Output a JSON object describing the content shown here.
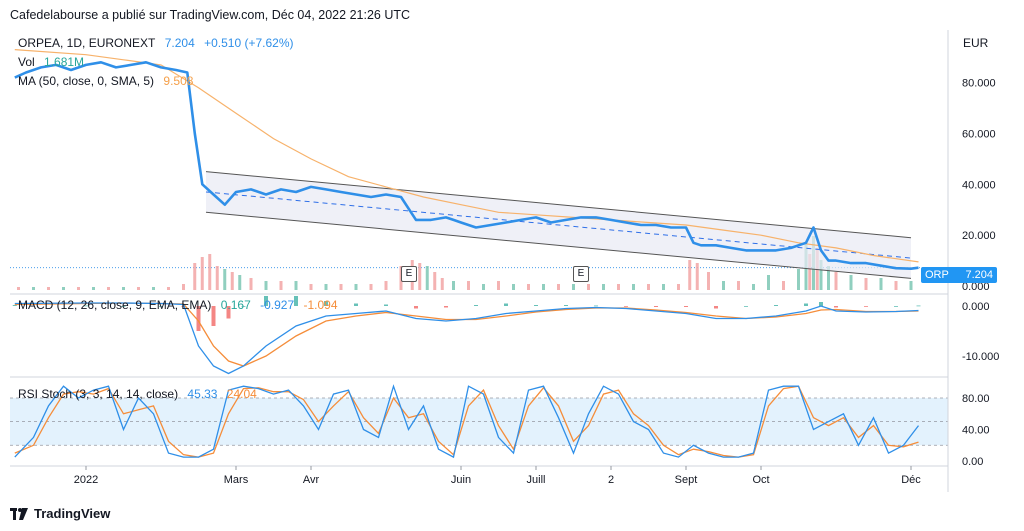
{
  "header": {
    "title": "Cafedelabourse a publié sur TradingView.com, Déc 04, 2022 21:26 UTC"
  },
  "footer": {
    "brand": "TradingView"
  },
  "main_legend": {
    "symbol": "ORPEA, 1D, EURONEXT",
    "price": "7.204",
    "change": "+0.510 (+7.62%)",
    "vol_label": "Vol",
    "vol_value": "1.681M",
    "ma_label": "MA (50, close, 0, SMA, 5)",
    "ma_value": "9.508"
  },
  "macd_legend": {
    "label": "MACD (12, 26, close, 9, EMA, EMA)",
    "v1": "0.167",
    "v2": "-0.927",
    "v3": "-1.094"
  },
  "rsi_legend": {
    "label": "RSI Stoch (3, 3, 14, 14, close)",
    "k": "45.33",
    "d": "24.04"
  },
  "price_tag": {
    "symbol": "ORP",
    "value": "7.204"
  },
  "axis_unit": "EUR",
  "earnings_markers": [
    {
      "label": "E",
      "month_pos": 4.75
    },
    {
      "label": "E",
      "month_pos": 7.35
    }
  ],
  "colors": {
    "price": "#2f8fe8",
    "ma": "#f7b26b",
    "channel": "#555555",
    "channel_fill": "#e8eaf4",
    "vol_up": "#7cc7b4",
    "vol_down": "#f2a4a4",
    "macd": "#2f8fe8",
    "signal": "#f58d3a",
    "rsi_k": "#2f8fe8",
    "rsi_d": "#f58d3a",
    "rsi_band": "#e3f2fd"
  },
  "chart_data": [
    {
      "type": "line",
      "name": "price",
      "x_ticks": [
        "2022",
        "Mars",
        "Avr",
        "Juin",
        "Juill",
        "2",
        "Sept",
        "Oct",
        "Déc"
      ],
      "x_tick_months": [
        0,
        2.0,
        3.0,
        5.0,
        6.0,
        7.0,
        8.0,
        9.0,
        11.0
      ],
      "y_ticks": [
        "80.000",
        "60.000",
        "40.000",
        "20.000",
        "0.000"
      ],
      "ylim": [
        0,
        96
      ],
      "series": [
        {
          "name": "ORPEA",
          "x_months": [
            -0.95,
            -0.8,
            -0.6,
            -0.4,
            -0.2,
            0,
            0.2,
            0.4,
            0.6,
            0.8,
            1.0,
            1.2,
            1.35,
            1.45,
            1.55,
            1.7,
            1.85,
            2.0,
            2.2,
            2.4,
            2.6,
            2.8,
            3.0,
            3.2,
            3.4,
            3.6,
            3.8,
            4.0,
            4.2,
            4.4,
            4.6,
            4.8,
            4.9,
            5.0,
            5.2,
            5.4,
            5.6,
            5.8,
            6.0,
            6.2,
            6.4,
            6.6,
            6.8,
            7.0,
            7.2,
            7.4,
            7.6,
            7.8,
            8.0,
            8.1,
            8.2,
            8.4,
            8.6,
            8.8,
            9.0,
            9.2,
            9.4,
            9.6,
            9.7,
            9.8,
            9.9,
            10.0,
            10.2,
            10.4,
            10.6,
            10.8,
            11.0,
            11.1
          ],
          "values": [
            82,
            84,
            86,
            87,
            85,
            87,
            88,
            86,
            87,
            88,
            86,
            85,
            84,
            60,
            40,
            36,
            32,
            37,
            38,
            36,
            38,
            37,
            39,
            38,
            37,
            36,
            35,
            36,
            35,
            26,
            26,
            27,
            26,
            25,
            23,
            24,
            25,
            26,
            27,
            25,
            26,
            27,
            27,
            26,
            25,
            24,
            24,
            23,
            23,
            17,
            16,
            16,
            15,
            14,
            14,
            14,
            15,
            17,
            23,
            14,
            10,
            10,
            9,
            9,
            8,
            7,
            6.8,
            7.2
          ]
        },
        {
          "name": "MA 50",
          "x_months": [
            -0.95,
            0,
            0.5,
            1.0,
            1.5,
            2.0,
            2.5,
            3.0,
            3.5,
            4.0,
            4.5,
            5.0,
            5.5,
            6.0,
            6.5,
            7.0,
            7.5,
            8.0,
            8.5,
            9.0,
            9.5,
            10.0,
            10.5,
            11.1
          ],
          "values": [
            93,
            91,
            89,
            87,
            78,
            68,
            58,
            50,
            43,
            39,
            35,
            32,
            29,
            28,
            27,
            26,
            25,
            24,
            22,
            20,
            17,
            15,
            12,
            9.5
          ]
        }
      ],
      "channel": {
        "upper": {
          "x_months": [
            1.6,
            11.0
          ],
          "values": [
            45,
            19
          ]
        },
        "lower": {
          "x_months": [
            1.6,
            11.0
          ],
          "values": [
            29,
            3
          ]
        },
        "mid": {
          "x_months": [
            1.6,
            11.0
          ],
          "values": [
            37,
            11
          ]
        }
      }
    },
    {
      "type": "bar",
      "name": "volume",
      "x_months": [
        -0.9,
        -0.7,
        -0.5,
        -0.3,
        -0.1,
        0.1,
        0.3,
        0.5,
        0.7,
        0.9,
        1.1,
        1.3,
        1.45,
        1.55,
        1.65,
        1.75,
        1.85,
        1.95,
        2.05,
        2.2,
        2.4,
        2.6,
        2.8,
        3.0,
        3.2,
        3.4,
        3.6,
        3.8,
        4.0,
        4.2,
        4.35,
        4.45,
        4.55,
        4.65,
        4.75,
        4.9,
        5.1,
        5.3,
        5.5,
        5.7,
        5.9,
        6.1,
        6.3,
        6.5,
        6.7,
        6.9,
        7.1,
        7.3,
        7.5,
        7.7,
        7.9,
        8.05,
        8.15,
        8.3,
        8.5,
        8.7,
        8.9,
        9.1,
        9.3,
        9.5,
        9.6,
        9.65,
        9.7,
        9.75,
        9.8,
        9.9,
        10.0,
        10.2,
        10.4,
        10.6,
        10.8,
        11.0
      ],
      "values": [
        1,
        1,
        1,
        1,
        1,
        1,
        1,
        1,
        1,
        1,
        1,
        2,
        9,
        11,
        12,
        8,
        7,
        6,
        5,
        4,
        3,
        3,
        3,
        2,
        2,
        2,
        2,
        2,
        3,
        8,
        10,
        9,
        8,
        6,
        4,
        3,
        3,
        2,
        3,
        2,
        2,
        2,
        2,
        2,
        2,
        2,
        2,
        2,
        2,
        2,
        2,
        10,
        9,
        6,
        3,
        3,
        2,
        5,
        3,
        7,
        16,
        12,
        18,
        14,
        10,
        8,
        6,
        5,
        4,
        4,
        3,
        3
      ],
      "direction": [
        "d",
        "u",
        "d",
        "u",
        "d",
        "u",
        "d",
        "u",
        "d",
        "u",
        "d",
        "d",
        "d",
        "d",
        "d",
        "d",
        "u",
        "d",
        "u",
        "d",
        "u",
        "d",
        "u",
        "d",
        "u",
        "d",
        "u",
        "d",
        "d",
        "d",
        "d",
        "d",
        "u",
        "d",
        "d",
        "u",
        "d",
        "u",
        "d",
        "u",
        "d",
        "u",
        "d",
        "u",
        "d",
        "u",
        "d",
        "u",
        "d",
        "u",
        "d",
        "d",
        "d",
        "d",
        "u",
        "d",
        "u",
        "u",
        "d",
        "u",
        "u",
        "d",
        "u",
        "d",
        "u",
        "u",
        "d",
        "u",
        "d",
        "u",
        "d",
        "u"
      ]
    },
    {
      "type": "line",
      "name": "MACD",
      "y_ticks": [
        "0.000",
        "-10.000"
      ],
      "ylim": [
        -14,
        2
      ],
      "series": [
        {
          "name": "MACD",
          "x_months": [
            -0.95,
            0,
            0.5,
            1.0,
            1.3,
            1.5,
            1.7,
            1.9,
            2.1,
            2.4,
            2.8,
            3.2,
            3.6,
            4.0,
            4.4,
            4.8,
            5.2,
            5.6,
            6.0,
            6.4,
            6.8,
            7.2,
            7.6,
            8.0,
            8.4,
            8.8,
            9.2,
            9.6,
            9.8,
            10.0,
            10.4,
            10.8,
            11.1
          ],
          "values": [
            0.5,
            0.6,
            0.6,
            0.5,
            0.3,
            -8,
            -12,
            -13.5,
            -12,
            -8,
            -4,
            -2,
            -1.5,
            -1,
            -2.5,
            -3,
            -2.5,
            -1.5,
            -1,
            -0.5,
            -0.3,
            -0.5,
            -1,
            -1.5,
            -2.5,
            -2.5,
            -2,
            -1,
            0,
            -1,
            -1.2,
            -1.1,
            -0.9
          ]
        },
        {
          "name": "Signal",
          "x_months": [
            -0.95,
            0,
            0.5,
            1.0,
            1.3,
            1.5,
            1.7,
            1.9,
            2.1,
            2.4,
            2.8,
            3.2,
            3.6,
            4.0,
            4.4,
            4.8,
            5.2,
            5.6,
            6.0,
            6.4,
            6.8,
            7.2,
            7.6,
            8.0,
            8.4,
            8.8,
            9.2,
            9.6,
            9.8,
            10.0,
            10.4,
            10.8,
            11.1
          ],
          "values": [
            0.3,
            0.5,
            0.6,
            0.5,
            0.4,
            -3,
            -8,
            -11,
            -12,
            -10,
            -6,
            -3,
            -2,
            -1.3,
            -2,
            -2.7,
            -2.7,
            -2,
            -1.2,
            -0.7,
            -0.4,
            -0.4,
            -0.8,
            -1.3,
            -2,
            -2.5,
            -2.2,
            -1.5,
            -0.8,
            -0.7,
            -1.1,
            -1.1,
            -1.0
          ]
        }
      ]
    },
    {
      "type": "line",
      "name": "RSI Stoch",
      "y_ticks": [
        "80.00",
        "40.00",
        "0.00"
      ],
      "ylim": [
        0,
        100
      ],
      "band": [
        20,
        80
      ],
      "series": [
        {
          "name": "K",
          "x_months": [
            -0.95,
            -0.7,
            -0.5,
            -0.3,
            -0.1,
            0.1,
            0.3,
            0.5,
            0.7,
            0.9,
            1.1,
            1.3,
            1.5,
            1.7,
            1.9,
            2.1,
            2.3,
            2.5,
            2.7,
            2.9,
            3.1,
            3.3,
            3.5,
            3.7,
            3.9,
            4.1,
            4.3,
            4.5,
            4.7,
            4.9,
            5.1,
            5.3,
            5.5,
            5.7,
            5.9,
            6.1,
            6.3,
            6.5,
            6.7,
            6.9,
            7.1,
            7.3,
            7.5,
            7.7,
            7.9,
            8.1,
            8.3,
            8.5,
            8.7,
            8.9,
            9.1,
            9.3,
            9.5,
            9.7,
            9.9,
            10.1,
            10.3,
            10.5,
            10.7,
            10.9,
            11.1
          ],
          "values": [
            5,
            30,
            70,
            95,
            80,
            90,
            95,
            40,
            80,
            60,
            10,
            5,
            5,
            15,
            90,
            95,
            92,
            85,
            90,
            70,
            40,
            85,
            90,
            40,
            30,
            95,
            40,
            70,
            15,
            5,
            95,
            85,
            30,
            10,
            90,
            95,
            55,
            10,
            60,
            95,
            85,
            50,
            40,
            10,
            5,
            20,
            10,
            5,
            5,
            10,
            90,
            95,
            95,
            40,
            50,
            60,
            20,
            55,
            10,
            20,
            45
          ]
        },
        {
          "name": "D",
          "x_months": [
            -0.95,
            -0.7,
            -0.5,
            -0.3,
            -0.1,
            0.1,
            0.3,
            0.5,
            0.7,
            0.9,
            1.1,
            1.3,
            1.5,
            1.7,
            1.9,
            2.1,
            2.3,
            2.5,
            2.7,
            2.9,
            3.1,
            3.3,
            3.5,
            3.7,
            3.9,
            4.1,
            4.3,
            4.5,
            4.7,
            4.9,
            5.1,
            5.3,
            5.5,
            5.7,
            5.9,
            6.1,
            6.3,
            6.5,
            6.7,
            6.9,
            7.1,
            7.3,
            7.5,
            7.7,
            7.9,
            8.1,
            8.3,
            8.5,
            8.7,
            8.9,
            9.1,
            9.3,
            9.5,
            9.7,
            9.9,
            10.1,
            10.3,
            10.5,
            10.7,
            10.9,
            11.1
          ],
          "values": [
            10,
            20,
            55,
            85,
            88,
            85,
            92,
            60,
            65,
            70,
            25,
            8,
            5,
            10,
            60,
            92,
            93,
            88,
            88,
            78,
            50,
            70,
            88,
            55,
            35,
            80,
            55,
            60,
            25,
            8,
            70,
            90,
            45,
            15,
            70,
            93,
            70,
            25,
            45,
            85,
            90,
            60,
            45,
            20,
            8,
            15,
            12,
            7,
            5,
            8,
            70,
            92,
            95,
            55,
            45,
            55,
            30,
            45,
            20,
            18,
            24
          ]
        }
      ]
    }
  ]
}
